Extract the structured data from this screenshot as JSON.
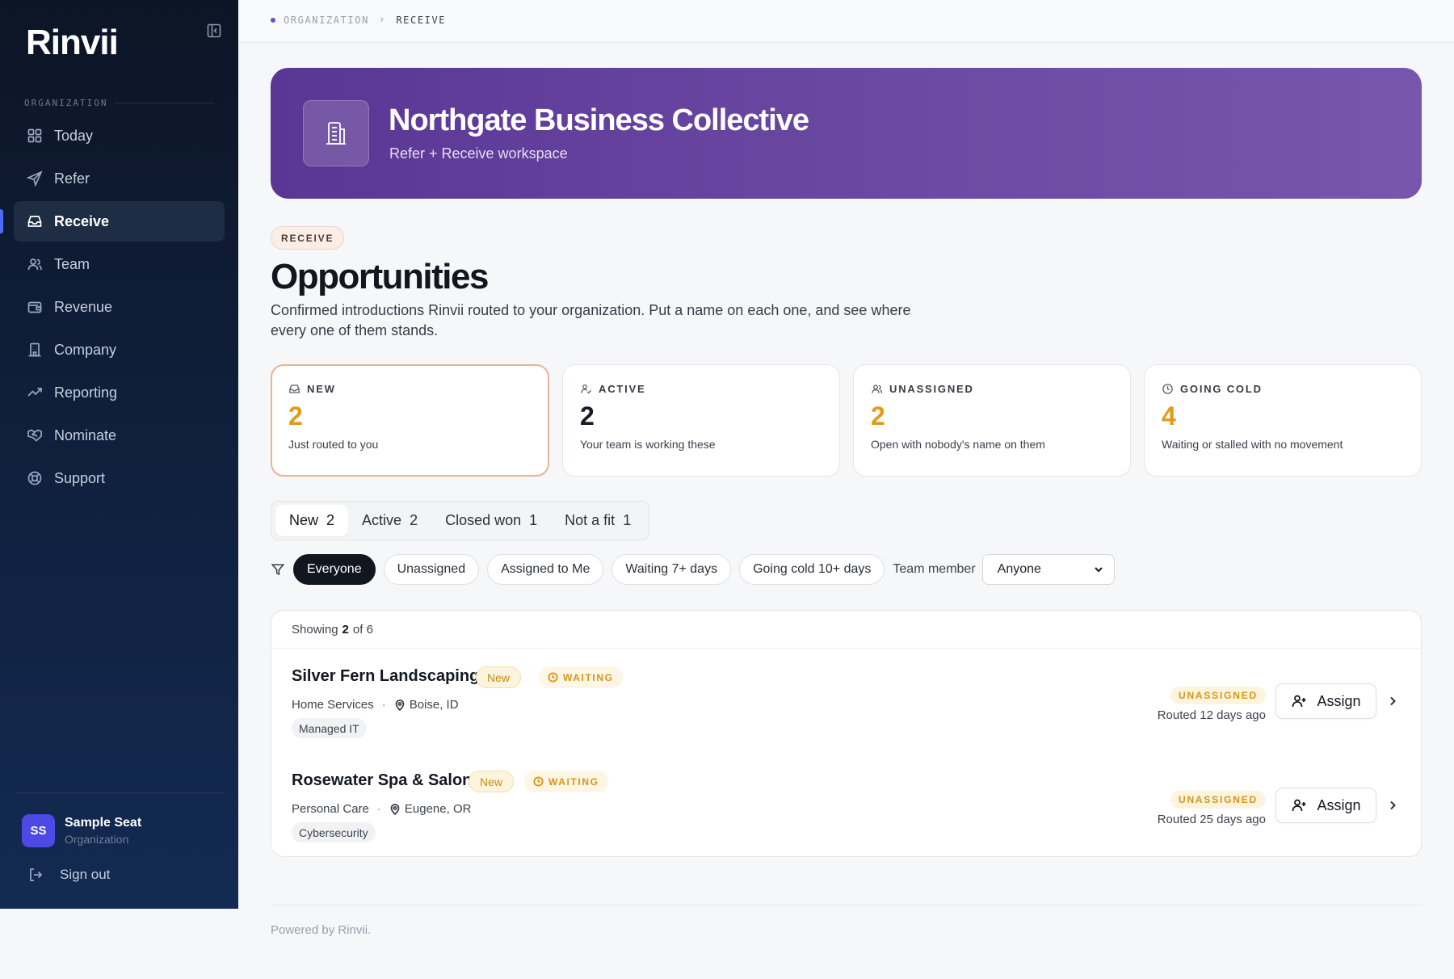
{
  "app": {
    "logo": "Rinvii"
  },
  "sidebar": {
    "section_label": "ORGANIZATION",
    "items": [
      {
        "label": "Today",
        "icon": "grid-icon"
      },
      {
        "label": "Refer",
        "icon": "send-icon"
      },
      {
        "label": "Receive",
        "icon": "inbox-icon",
        "active": true
      },
      {
        "label": "Team",
        "icon": "users-icon"
      },
      {
        "label": "Revenue",
        "icon": "wallet-icon"
      },
      {
        "label": "Company",
        "icon": "building-icon"
      },
      {
        "label": "Reporting",
        "icon": "trend-icon"
      },
      {
        "label": "Nominate",
        "icon": "handshake-icon"
      },
      {
        "label": "Support",
        "icon": "lifebuoy-icon"
      }
    ],
    "user": {
      "initials": "SS",
      "name": "Sample Seat",
      "org": "Organization"
    },
    "signout": "Sign out"
  },
  "breadcrumb": {
    "parent": "ORGANIZATION",
    "current": "RECEIVE"
  },
  "hero": {
    "title": "Northgate Business Collective",
    "subtitle": "Refer + Receive workspace"
  },
  "page": {
    "tag": "RECEIVE",
    "title": "Opportunities",
    "description": "Confirmed introductions Rinvii routed to your organization. Put a name on each one, and see where every one of them stands."
  },
  "stats": [
    {
      "label": "NEW",
      "value": "2",
      "sub": "Just routed to you",
      "color": "#e39a17"
    },
    {
      "label": "ACTIVE",
      "value": "2",
      "sub": "Your team is working these",
      "color": "#171b24"
    },
    {
      "label": "UNASSIGNED",
      "value": "2",
      "sub": "Open with nobody's name on them",
      "color": "#e39a17"
    },
    {
      "label": "GOING COLD",
      "value": "4",
      "sub": "Waiting or stalled with no movement",
      "color": "#e39a17"
    }
  ],
  "tabs": [
    {
      "label": "New",
      "count": "2"
    },
    {
      "label": "Active",
      "count": "2"
    },
    {
      "label": "Closed won",
      "count": "1"
    },
    {
      "label": "Not a fit",
      "count": "1"
    }
  ],
  "filters": {
    "chips": [
      "Everyone",
      "Unassigned",
      "Assigned to Me",
      "Waiting 7+ days",
      "Going cold 10+ days"
    ],
    "team_label": "Team member",
    "team_value": "Anyone"
  },
  "list": {
    "showing_prefix": "Showing",
    "showing_count": "2",
    "showing_suffix": "of 6",
    "rows": [
      {
        "name": "Silver Fern Landscaping",
        "status": "New",
        "waiting": "WAITING",
        "category": "Home Services",
        "location": "Boise, ID",
        "tag": "Managed IT",
        "assignment": "UNASSIGNED",
        "routed": "Routed 12 days ago",
        "action": "Assign"
      },
      {
        "name": "Rosewater Spa & Salon",
        "status": "New",
        "waiting": "WAITING",
        "category": "Personal Care",
        "location": "Eugene, OR",
        "tag": "Cybersecurity",
        "assignment": "UNASSIGNED",
        "routed": "Routed 25 days ago",
        "action": "Assign"
      }
    ]
  },
  "footer": "Powered by Rinvii."
}
